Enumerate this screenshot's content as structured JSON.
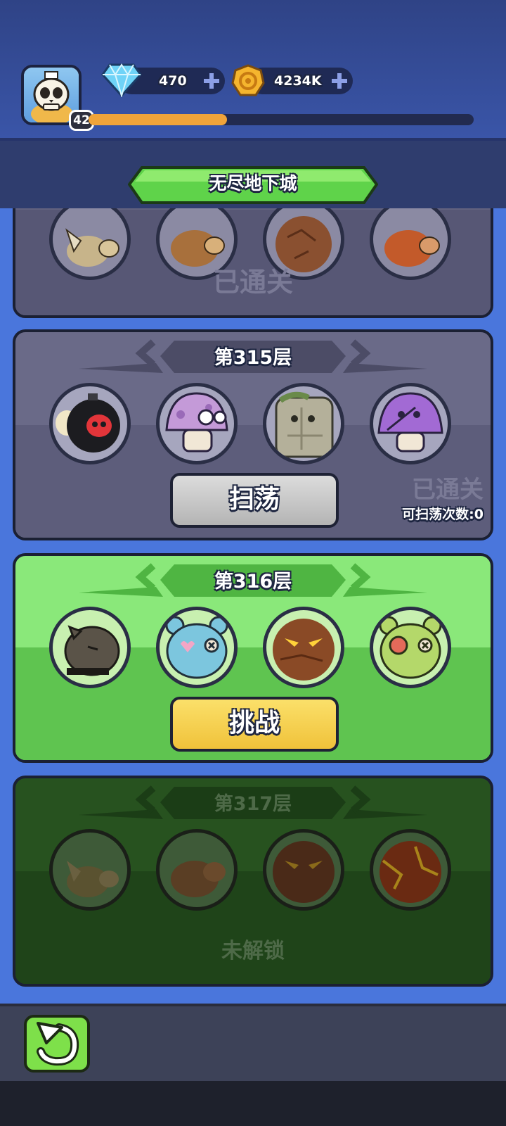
{
  "header": {
    "player_level": "42",
    "xp_progress": 0.36,
    "gems": {
      "icon": "diamond-icon",
      "value": "470"
    },
    "gold": {
      "icon": "gold-coin-icon",
      "value": "4234K"
    }
  },
  "title": "无尽地下城",
  "floors": [
    {
      "name": "",
      "status_text": "已通关",
      "monsters": [
        "winged-camel-icon",
        "camel-icon",
        "rock-golem-icon",
        "lava-camel-icon"
      ]
    },
    {
      "name": "第315层",
      "button_label": "扫荡",
      "status_text": "已通关",
      "sweep_count_text": "可扫荡次数:0",
      "monsters": [
        "skull-bomb-icon",
        "purple-mushroom-icon",
        "stone-golem-icon",
        "stitched-mushroom-icon"
      ]
    },
    {
      "name": "第316层",
      "button_label": "挑战",
      "monsters": [
        "dark-rat-icon",
        "blue-bear-icon",
        "fire-golem-icon",
        "green-bear-icon"
      ]
    },
    {
      "name": "第317层",
      "status_text": "未解锁",
      "monsters": [
        "winged-camel-icon",
        "camel-icon",
        "rock-golem-icon",
        "lava-golem-icon"
      ]
    }
  ],
  "footer": {
    "back_icon": "back-arrow-icon"
  },
  "colors": {
    "cleared_card": "#62627f",
    "active_card": "#8ae87a",
    "locked_card": "#27521f",
    "sweep_button": "#c4c4c4",
    "challenge_button": "#f6d24a"
  }
}
